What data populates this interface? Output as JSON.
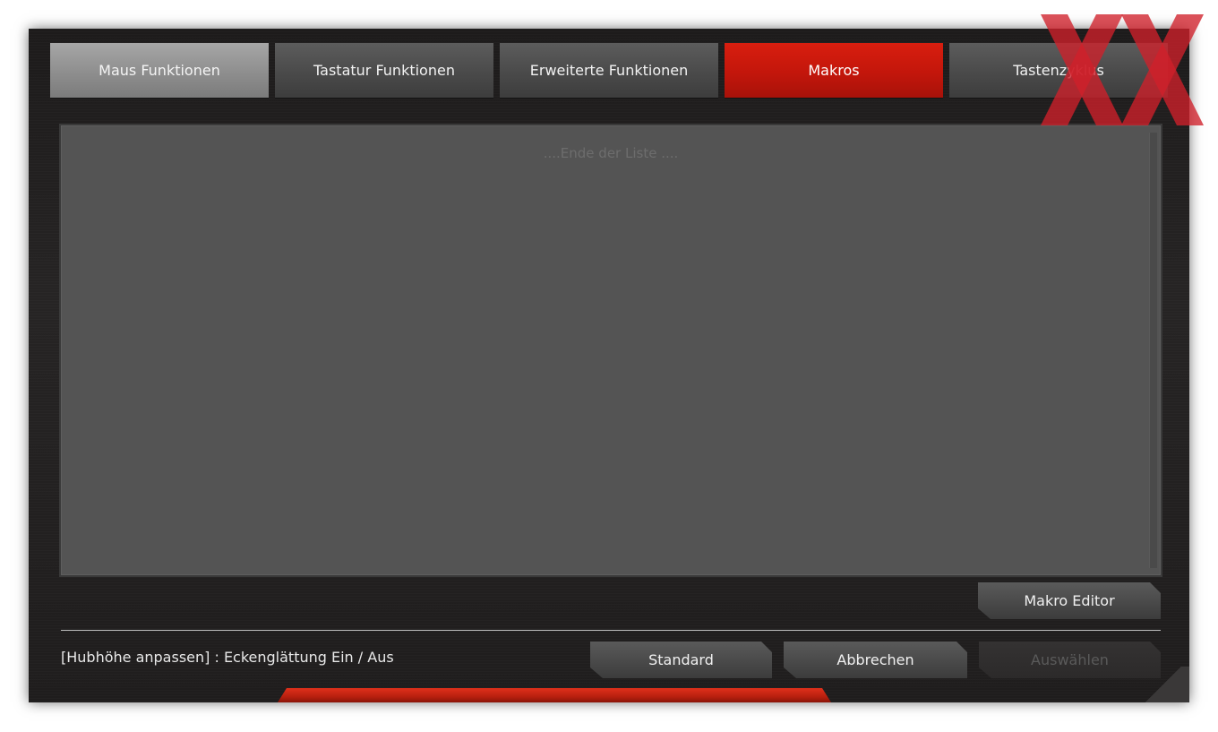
{
  "tabs": [
    {
      "label": "Maus Funktionen"
    },
    {
      "label": "Tastatur Funktionen"
    },
    {
      "label": "Erweiterte Funktionen"
    },
    {
      "label": "Makros"
    },
    {
      "label": "Tastenzyklus"
    }
  ],
  "list": {
    "end_text": "....Ende der Liste ...."
  },
  "buttons": {
    "macro_editor": "Makro Editor",
    "default": "Standard",
    "cancel": "Abbrechen",
    "select": "Auswählen"
  },
  "hint": "[Hubhöhe anpassen] : Eckenglättung Ein / Aus",
  "logo": {
    "icon": "xx-logo-icon",
    "color": "#d0202a"
  },
  "colors": {
    "accent": "#c3160b",
    "panel": "#545454"
  }
}
